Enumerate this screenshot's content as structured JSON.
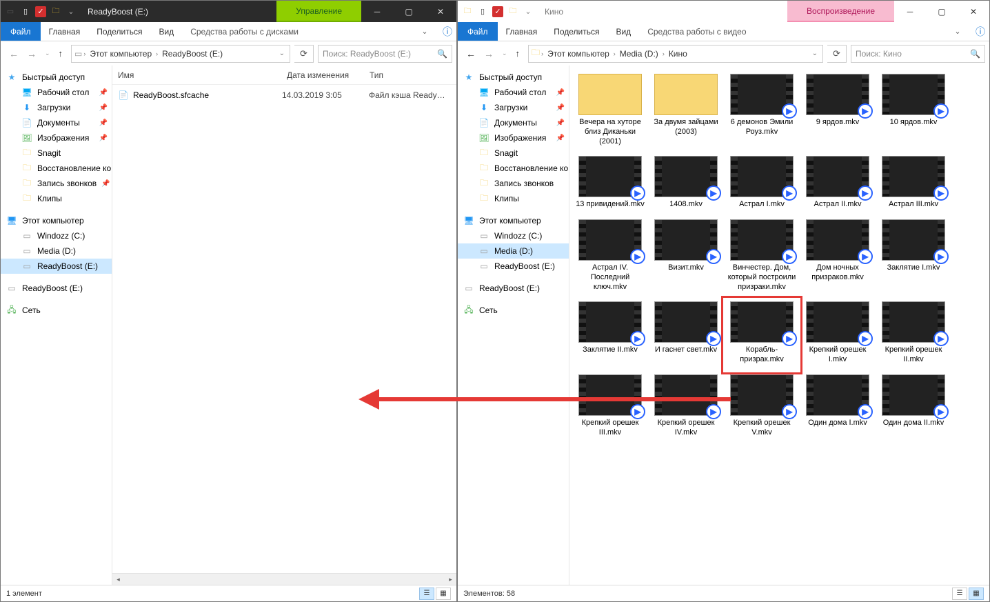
{
  "left": {
    "title": "ReadyBoost (E:)",
    "context_tab": "Управление",
    "ribbon_file": "Файл",
    "tabs": [
      "Главная",
      "Поделиться",
      "Вид"
    ],
    "context_tool": "Средства работы с дисками",
    "breadcrumb": [
      "Этот компьютер",
      "ReadyBoost (E:)"
    ],
    "search_placeholder": "Поиск: ReadyBoost (E:)",
    "columns": {
      "name": "Имя",
      "date": "Дата изменения",
      "type": "Тип"
    },
    "files": [
      {
        "name": "ReadyBoost.sfcache",
        "date": "14.03.2019 3:05",
        "type": "Файл кэша Ready…"
      }
    ],
    "sidebar": {
      "quick": "Быстрый доступ",
      "quick_items": [
        {
          "label": "Рабочий стол",
          "icon": "desktop",
          "pinned": true
        },
        {
          "label": "Загрузки",
          "icon": "download",
          "pinned": true
        },
        {
          "label": "Документы",
          "icon": "doc",
          "pinned": true
        },
        {
          "label": "Изображения",
          "icon": "image",
          "pinned": true
        },
        {
          "label": "Snagit",
          "icon": "folder"
        },
        {
          "label": "Восстановление ко",
          "icon": "folder"
        },
        {
          "label": "Запись звонков",
          "icon": "folder",
          "pinned": true
        },
        {
          "label": "Клипы",
          "icon": "folder"
        }
      ],
      "thispc": "Этот компьютер",
      "drives": [
        {
          "label": "Windozz (C:)",
          "icon": "drive"
        },
        {
          "label": "Media (D:)",
          "icon": "drive"
        },
        {
          "label": "ReadyBoost (E:)",
          "icon": "drive",
          "selected": true
        }
      ],
      "extra_drive": "ReadyBoost (E:)",
      "network": "Сеть"
    },
    "status": "1 элемент"
  },
  "right": {
    "title": "Кино",
    "context_tab": "Воспроизведение",
    "ribbon_file": "Файл",
    "tabs": [
      "Главная",
      "Поделиться",
      "Вид"
    ],
    "context_tool": "Средства работы с видео",
    "breadcrumb": [
      "Этот компьютер",
      "Media (D:)",
      "Кино"
    ],
    "search_placeholder": "Поиск: Кино",
    "sidebar": {
      "quick": "Быстрый доступ",
      "quick_items": [
        {
          "label": "Рабочий стол",
          "icon": "desktop",
          "pinned": true
        },
        {
          "label": "Загрузки",
          "icon": "download",
          "pinned": true
        },
        {
          "label": "Документы",
          "icon": "doc",
          "pinned": true
        },
        {
          "label": "Изображения",
          "icon": "image",
          "pinned": true
        },
        {
          "label": "Snagit",
          "icon": "folder"
        },
        {
          "label": "Восстановление ко",
          "icon": "folder"
        },
        {
          "label": "Запись звонков",
          "icon": "folder"
        },
        {
          "label": "Клипы",
          "icon": "folder"
        }
      ],
      "thispc": "Этот компьютер",
      "drives": [
        {
          "label": "Windozz (C:)",
          "icon": "drive"
        },
        {
          "label": "Media (D:)",
          "icon": "drive",
          "selected": true
        },
        {
          "label": "ReadyBoost (E:)",
          "icon": "drive"
        }
      ],
      "extra_drive": "ReadyBoost (E:)",
      "network": "Сеть"
    },
    "items": [
      {
        "label": "Вечера на хуторе близ Диканьки (2001)",
        "type": "folder"
      },
      {
        "label": "За двумя зайцами (2003)",
        "type": "folder"
      },
      {
        "label": "6 демонов Эмили Роуз.mkv",
        "type": "video"
      },
      {
        "label": "9 ярдов.mkv",
        "type": "video"
      },
      {
        "label": "10 ярдов.mkv",
        "type": "video"
      },
      {
        "label": "13 привидений.mkv",
        "type": "video"
      },
      {
        "label": "1408.mkv",
        "type": "video"
      },
      {
        "label": "Астрал I.mkv",
        "type": "video"
      },
      {
        "label": "Астрал II.mkv",
        "type": "video"
      },
      {
        "label": "Астрал III.mkv",
        "type": "video"
      },
      {
        "label": "Астрал IV. Последний ключ.mkv",
        "type": "video"
      },
      {
        "label": "Визит.mkv",
        "type": "video"
      },
      {
        "label": "Винчестер. Дом, который построили призраки.mkv",
        "type": "video"
      },
      {
        "label": "Дом ночных призраков.mkv",
        "type": "video"
      },
      {
        "label": "Заклятие I.mkv",
        "type": "video"
      },
      {
        "label": "Заклятие II.mkv",
        "type": "video"
      },
      {
        "label": "И гаснет свет.mkv",
        "type": "video"
      },
      {
        "label": "Корабль-призрак.mkv",
        "type": "video",
        "selected": true
      },
      {
        "label": "Крепкий орешек I.mkv",
        "type": "video"
      },
      {
        "label": "Крепкий орешек II.mkv",
        "type": "video"
      },
      {
        "label": "Крепкий орешек III.mkv",
        "type": "video"
      },
      {
        "label": "Крепкий орешек IV.mkv",
        "type": "video"
      },
      {
        "label": "Крепкий орешек V.mkv",
        "type": "video"
      },
      {
        "label": "Один дома I.mkv",
        "type": "video"
      },
      {
        "label": "Один дома II.mkv",
        "type": "video"
      }
    ],
    "status": "Элементов: 58"
  }
}
